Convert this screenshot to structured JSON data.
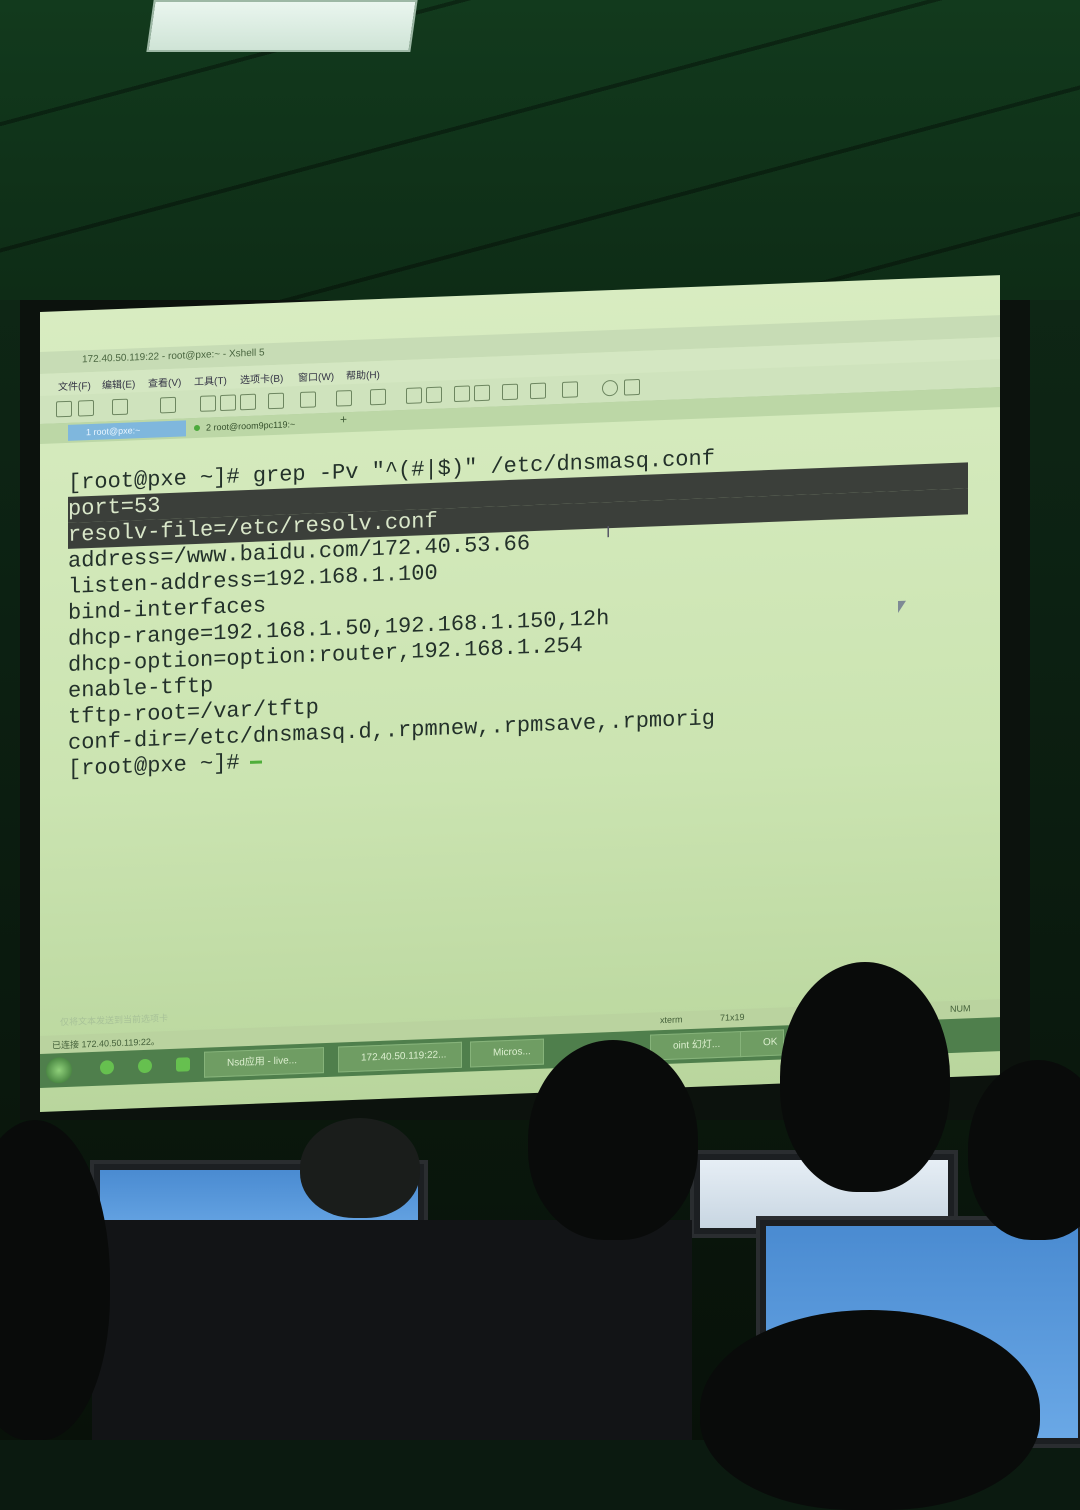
{
  "window": {
    "title": "172.40.50.119:22 - root@pxe:~ - Xshell 5",
    "controls": [
      "_",
      "□",
      "✕"
    ]
  },
  "menu": [
    "文件(F)",
    "编辑(E)",
    "查看(V)",
    "工具(T)",
    "选项卡(B)",
    "窗口(W)",
    "帮助(H)"
  ],
  "tabs": [
    {
      "label": "1 root@pxe:~",
      "active": true
    },
    {
      "label": "2 root@room9pc119:~",
      "active": false
    }
  ],
  "tab_add": "+",
  "terminal": {
    "lines": [
      "[root@pxe ~]# grep -Pv \"^(#|$)\" /etc/dnsmasq.conf",
      "port=53",
      "resolv-file=/etc/resolv.conf",
      "address=/www.baidu.com/172.40.53.66",
      "listen-address=192.168.1.100",
      "bind-interfaces",
      "dhcp-range=192.168.1.50,192.168.1.150,12h",
      "dhcp-option=option:router,192.168.1.254",
      "enable-tftp",
      "tftp-root=/var/tftp",
      "conf-dir=/etc/dnsmasq.d,.rpmnew,.rpmsave,.rpmorig",
      "[root@pxe ~]#"
    ],
    "selected_lines": [
      1,
      2
    ]
  },
  "status": {
    "hint": "仅将文本发送到当前选项卡",
    "connection": "已连接 172.40.50.119:22。",
    "term_type": "xterm",
    "size": "71x19",
    "num": "NUM"
  },
  "taskbar": {
    "items": [
      "Nsd应用 - live...",
      "172.40.50.119:22...",
      "Micros...",
      "oint 幻灯...",
      "OK"
    ]
  },
  "colors": {
    "screen_bg": "#d3e9bb",
    "selection_bg": "#3b3f3a",
    "tab_active": "#7fb7dd",
    "cursor": "#4fae3a"
  }
}
